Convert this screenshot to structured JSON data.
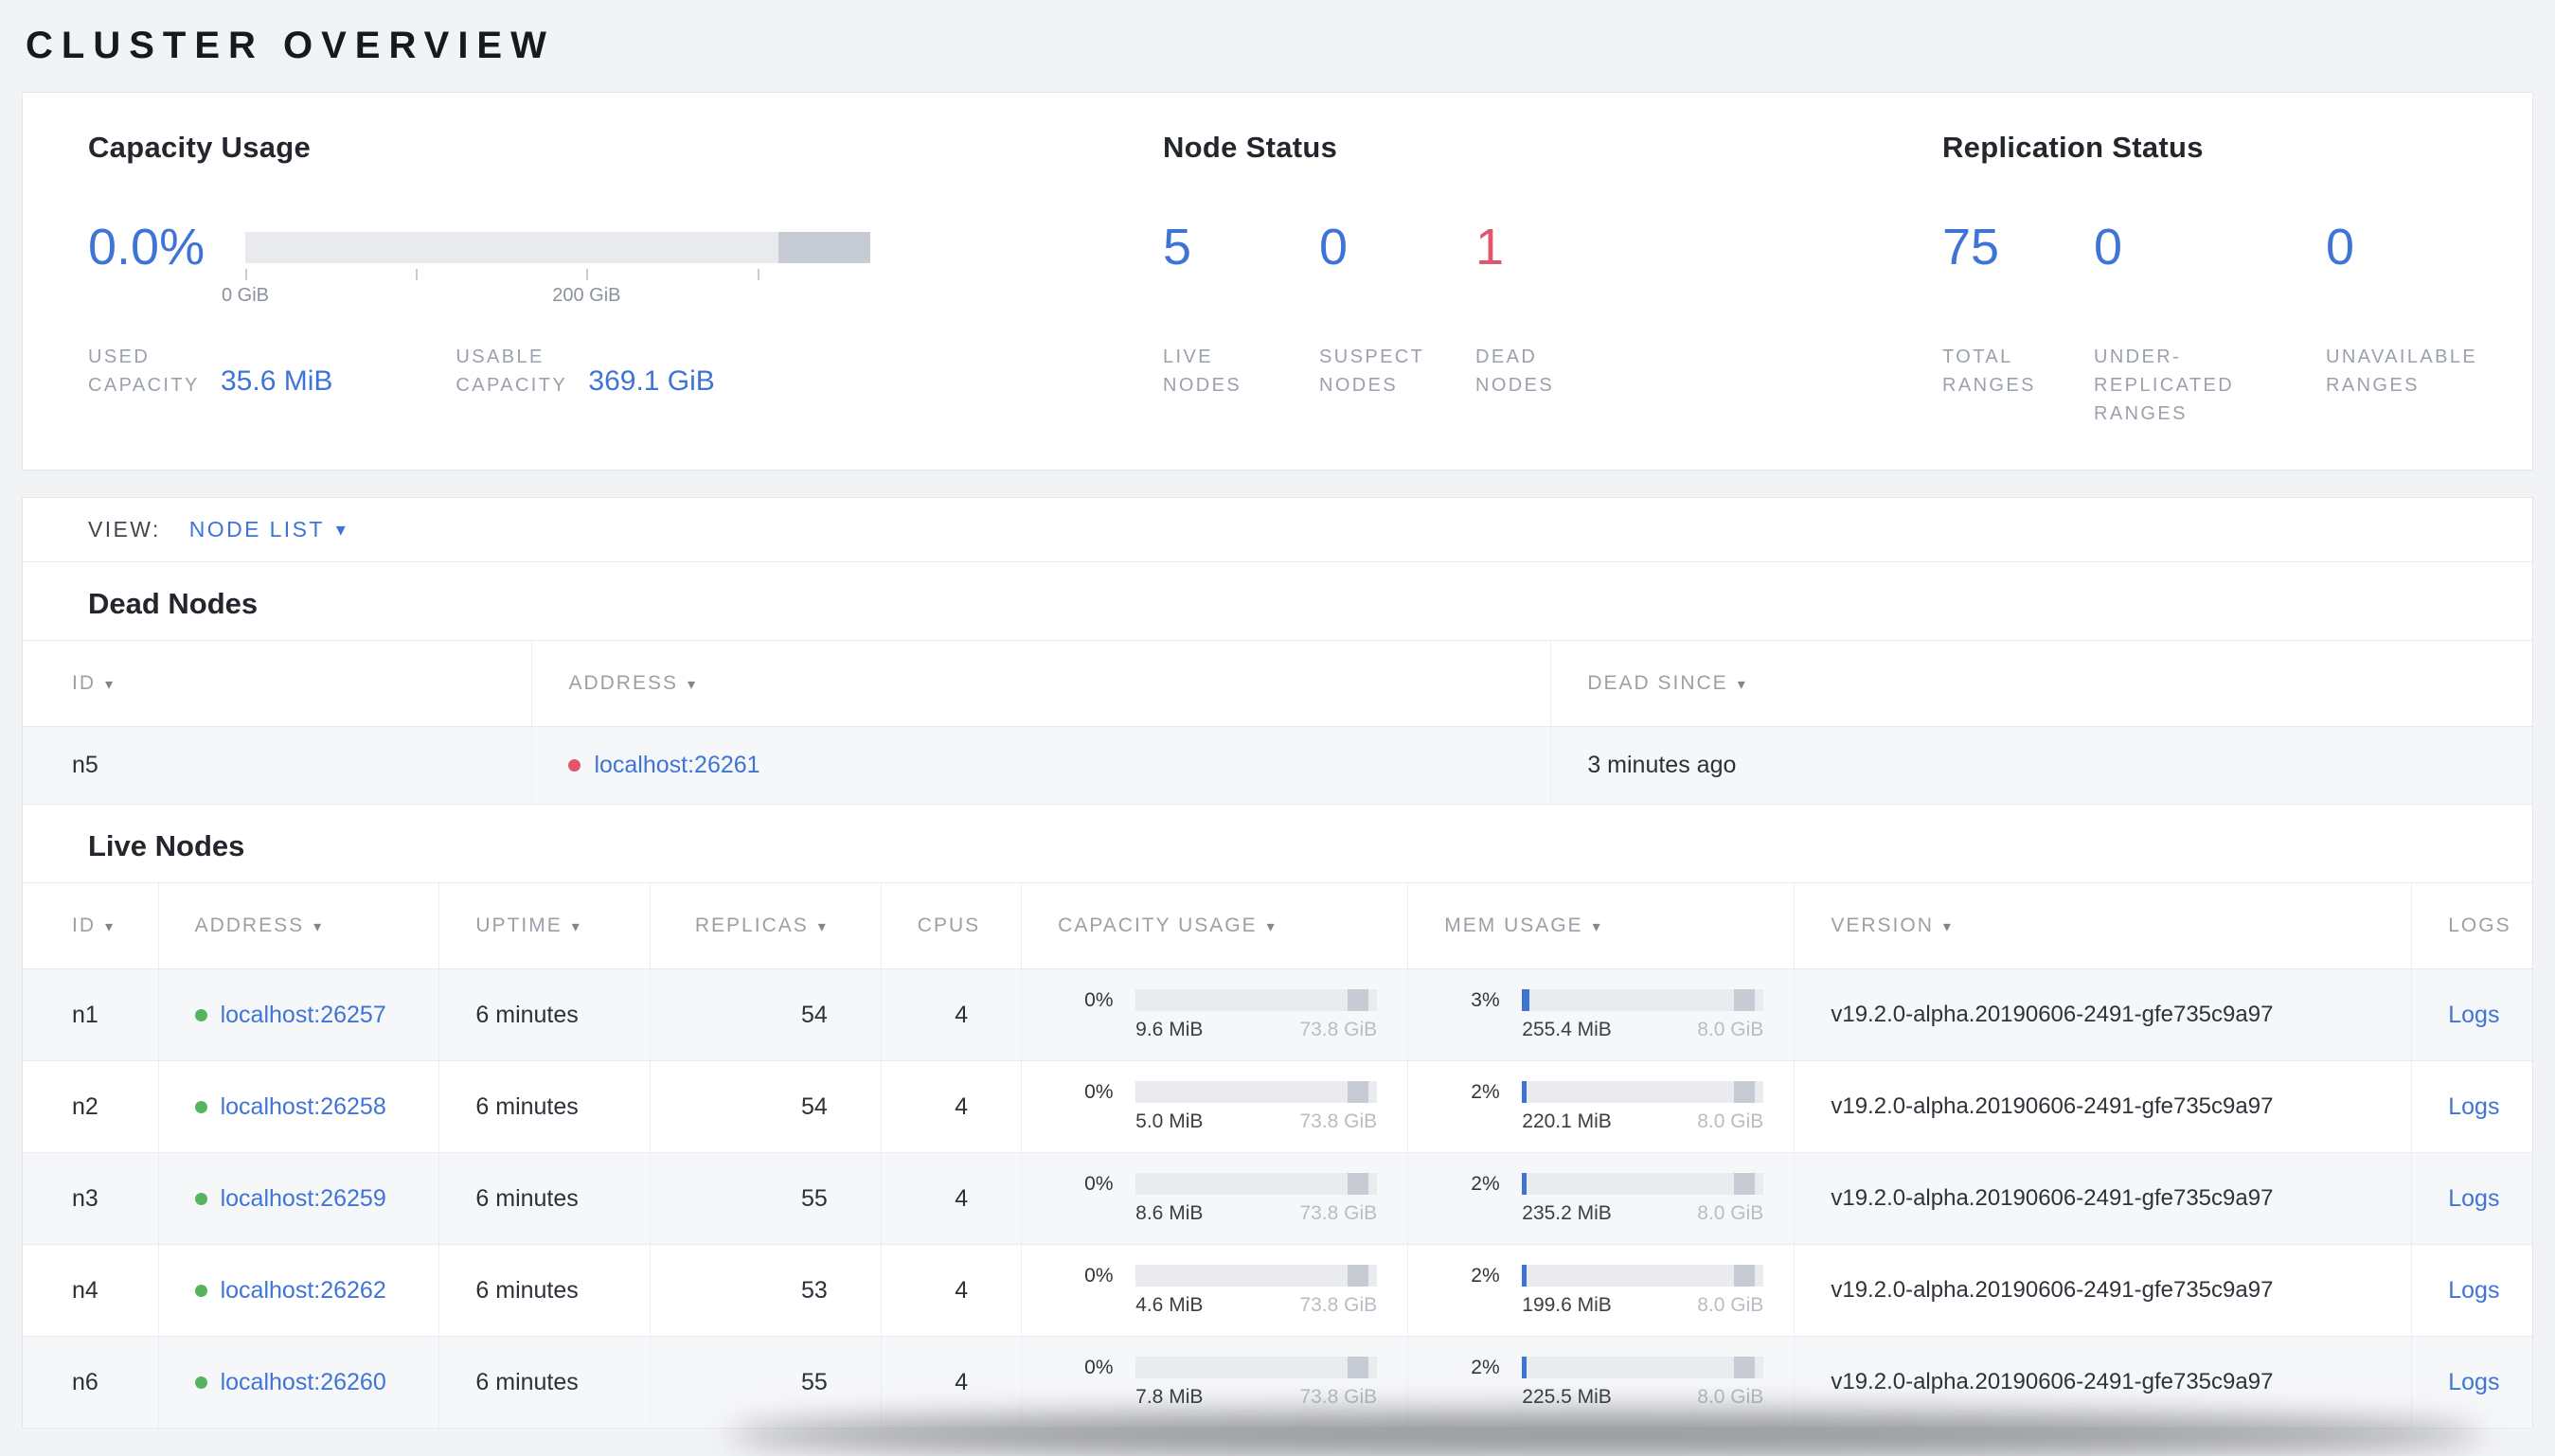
{
  "colors": {
    "accent_blue": "#3f74d7",
    "danger_red": "#e1566c",
    "live_green": "#56b45e",
    "label_gray": "#9ba1ab"
  },
  "page": {
    "title": "CLUSTER OVERVIEW"
  },
  "summary": {
    "capacity": {
      "title": "Capacity Usage",
      "percent": "0.0%",
      "bar_tick_labels": [
        "0 GiB",
        "200 GiB"
      ],
      "stats": [
        {
          "label": "USED CAPACITY",
          "value": "35.6 MiB"
        },
        {
          "label": "USABLE CAPACITY",
          "value": "369.1 GiB"
        }
      ]
    },
    "node_status": {
      "title": "Node Status",
      "stats": [
        {
          "value": "5",
          "label": "LIVE NODES"
        },
        {
          "value": "0",
          "label": "SUSPECT NODES"
        },
        {
          "value": "1",
          "label": "DEAD NODES"
        }
      ]
    },
    "replication": {
      "title": "Replication Status",
      "stats": [
        {
          "value": "75",
          "label": "TOTAL RANGES"
        },
        {
          "value": "0",
          "label": "UNDER-REPLICATED RANGES"
        },
        {
          "value": "0",
          "label": "UNAVAILABLE RANGES"
        }
      ]
    }
  },
  "view_bar": {
    "label": "VIEW:",
    "selected": "NODE LIST",
    "caret_icon": "▾"
  },
  "dead_nodes": {
    "title": "Dead Nodes",
    "columns": [
      {
        "label": "ID",
        "sort_icon": "▾",
        "align": "left"
      },
      {
        "label": "ADDRESS",
        "sort_icon": "▾",
        "align": "left"
      },
      {
        "label": "DEAD SINCE",
        "sort_icon": "▾",
        "align": "left"
      }
    ],
    "rows": [
      {
        "id": "n5",
        "address": "localhost:26261",
        "dead_since": "3 minutes ago"
      }
    ]
  },
  "live_nodes": {
    "title": "Live Nodes",
    "columns": [
      {
        "label": "ID",
        "sort_icon": "▾",
        "align": "left"
      },
      {
        "label": "ADDRESS",
        "sort_icon": "▾",
        "align": "left"
      },
      {
        "label": "UPTIME",
        "sort_icon": "▾",
        "align": "left"
      },
      {
        "label": "REPLICAS",
        "sort_icon": "▾",
        "align": "right"
      },
      {
        "label": "CPUS",
        "sort_icon": "",
        "align": "right"
      },
      {
        "label": "CAPACITY USAGE",
        "sort_icon": "▾",
        "align": "left"
      },
      {
        "label": "MEM USAGE",
        "sort_icon": "▾",
        "align": "left"
      },
      {
        "label": "VERSION",
        "sort_icon": "▾",
        "align": "left"
      },
      {
        "label": "LOGS",
        "sort_icon": "",
        "align": "left"
      }
    ],
    "rows": [
      {
        "id": "n1",
        "address": "localhost:26257",
        "uptime": "6 minutes",
        "replicas": "54",
        "cpus": "4",
        "capacity": {
          "pct": "0%",
          "pct_num": 0,
          "used": "9.6 MiB",
          "total": "73.8 GiB"
        },
        "mem": {
          "pct": "3%",
          "pct_num": 3,
          "used": "255.4 MiB",
          "total": "8.0 GiB"
        },
        "version": "v19.2.0-alpha.20190606-2491-gfe735c9a97",
        "logs_label": "Logs"
      },
      {
        "id": "n2",
        "address": "localhost:26258",
        "uptime": "6 minutes",
        "replicas": "54",
        "cpus": "4",
        "capacity": {
          "pct": "0%",
          "pct_num": 0,
          "used": "5.0 MiB",
          "total": "73.8 GiB"
        },
        "mem": {
          "pct": "2%",
          "pct_num": 2,
          "used": "220.1 MiB",
          "total": "8.0 GiB"
        },
        "version": "v19.2.0-alpha.20190606-2491-gfe735c9a97",
        "logs_label": "Logs"
      },
      {
        "id": "n3",
        "address": "localhost:26259",
        "uptime": "6 minutes",
        "replicas": "55",
        "cpus": "4",
        "capacity": {
          "pct": "0%",
          "pct_num": 0,
          "used": "8.6 MiB",
          "total": "73.8 GiB"
        },
        "mem": {
          "pct": "2%",
          "pct_num": 2,
          "used": "235.2 MiB",
          "total": "8.0 GiB"
        },
        "version": "v19.2.0-alpha.20190606-2491-gfe735c9a97",
        "logs_label": "Logs"
      },
      {
        "id": "n4",
        "address": "localhost:26262",
        "uptime": "6 minutes",
        "replicas": "53",
        "cpus": "4",
        "capacity": {
          "pct": "0%",
          "pct_num": 0,
          "used": "4.6 MiB",
          "total": "73.8 GiB"
        },
        "mem": {
          "pct": "2%",
          "pct_num": 2,
          "used": "199.6 MiB",
          "total": "8.0 GiB"
        },
        "version": "v19.2.0-alpha.20190606-2491-gfe735c9a97",
        "logs_label": "Logs"
      },
      {
        "id": "n6",
        "address": "localhost:26260",
        "uptime": "6 minutes",
        "replicas": "55",
        "cpus": "4",
        "capacity": {
          "pct": "0%",
          "pct_num": 0,
          "used": "7.8 MiB",
          "total": "73.8 GiB"
        },
        "mem": {
          "pct": "2%",
          "pct_num": 2,
          "used": "225.5 MiB",
          "total": "8.0 GiB"
        },
        "version": "v19.2.0-alpha.20190606-2491-gfe735c9a97",
        "logs_label": "Logs"
      }
    ]
  }
}
